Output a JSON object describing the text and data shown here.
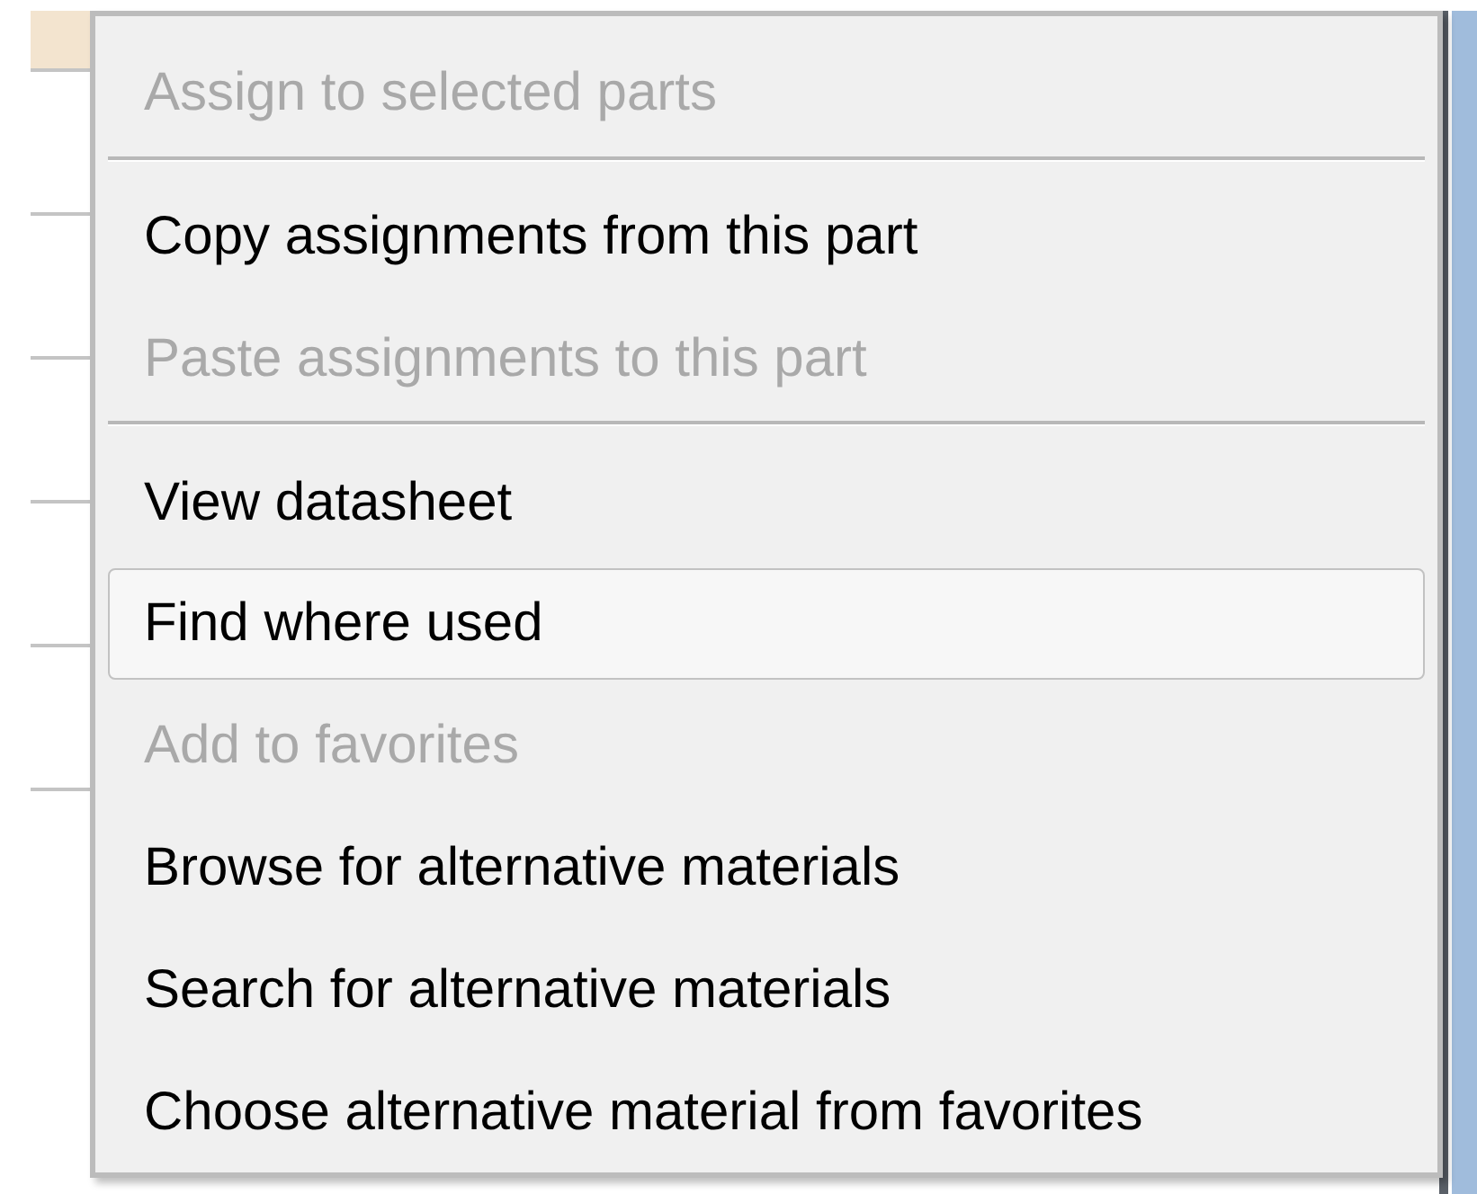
{
  "context_menu": {
    "items": [
      {
        "kind": "item",
        "label": "Assign to selected parts",
        "disabled": true,
        "selected": false
      },
      {
        "kind": "separator"
      },
      {
        "kind": "item",
        "label": "Copy assignments from this part",
        "disabled": false,
        "selected": false
      },
      {
        "kind": "item",
        "label": "Paste assignments to this part",
        "disabled": true,
        "selected": false
      },
      {
        "kind": "separator"
      },
      {
        "kind": "item",
        "label": "View datasheet",
        "disabled": false,
        "selected": false
      },
      {
        "kind": "item",
        "label": "Find where used",
        "disabled": false,
        "selected": true
      },
      {
        "kind": "item",
        "label": "Add to favorites",
        "disabled": true,
        "selected": false
      },
      {
        "kind": "item",
        "label": "Browse for alternative materials",
        "disabled": false,
        "selected": false
      },
      {
        "kind": "item",
        "label": "Search for alternative materials",
        "disabled": false,
        "selected": false
      },
      {
        "kind": "item",
        "label": "Choose alternative material from favorites",
        "disabled": false,
        "selected": false
      }
    ]
  }
}
